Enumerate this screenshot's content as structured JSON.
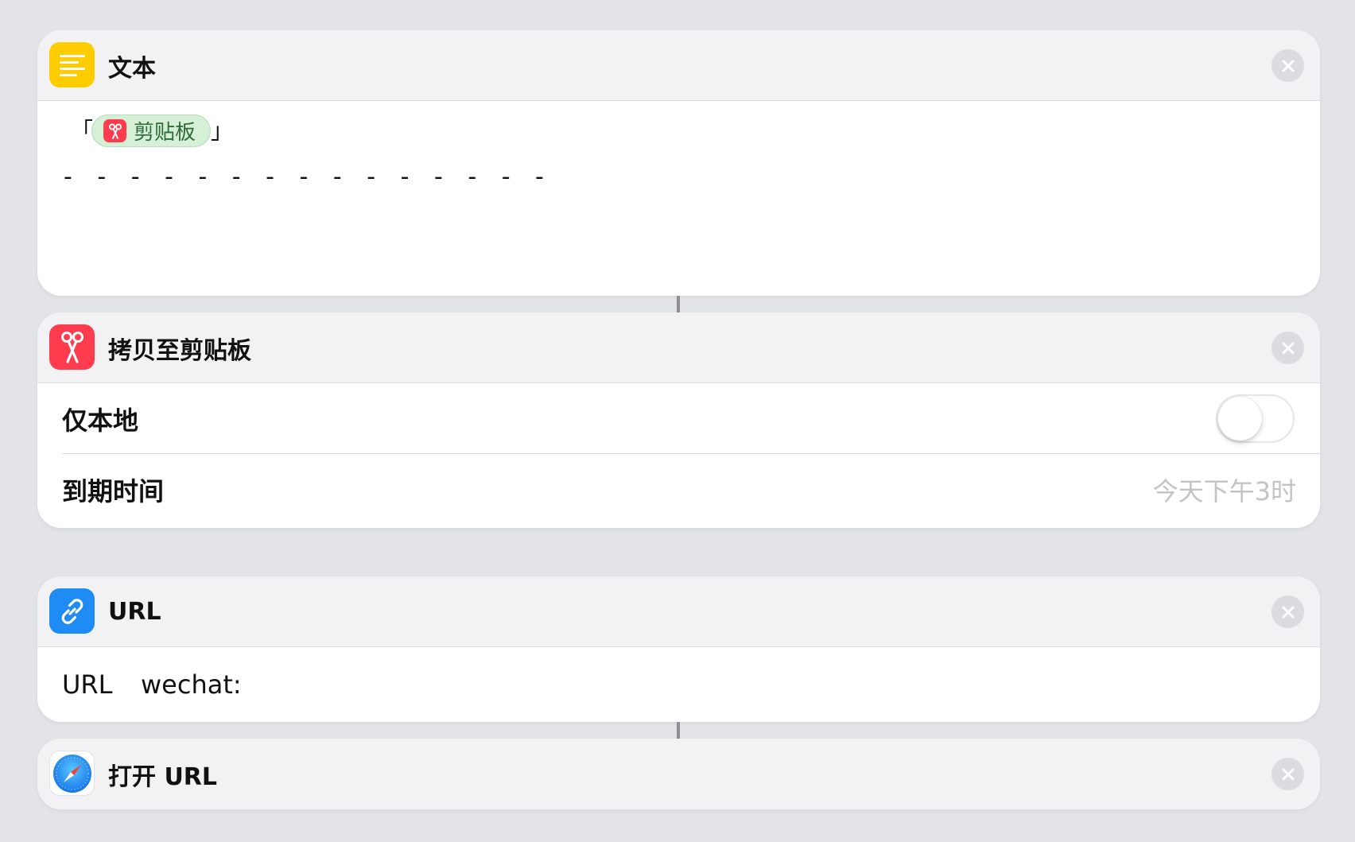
{
  "text_action": {
    "title": "文本",
    "icon": "text-lines-icon",
    "open_bracket": "「",
    "close_bracket": "」",
    "variable_token": "剪贴板",
    "dash_line": "- - - - - - - - - - - - - - -"
  },
  "copy_action": {
    "title": "拷贝至剪贴板",
    "icon": "scissors-icon",
    "local_only_label": "仅本地",
    "local_only_on": false,
    "expire_label": "到期时间",
    "expire_value": "今天下午3时"
  },
  "url_action": {
    "title": "URL",
    "icon": "link-icon",
    "field_label": "URL",
    "field_value": "wechat:"
  },
  "open_url_action": {
    "title": "打开 URL",
    "icon": "safari-compass-icon"
  },
  "colors": {
    "text_icon_bg": "#ffcc00",
    "scissors_icon_bg": "#ff3b4e",
    "link_icon_bg": "#1f8bf5",
    "token_bg": "#d6f0d8"
  }
}
